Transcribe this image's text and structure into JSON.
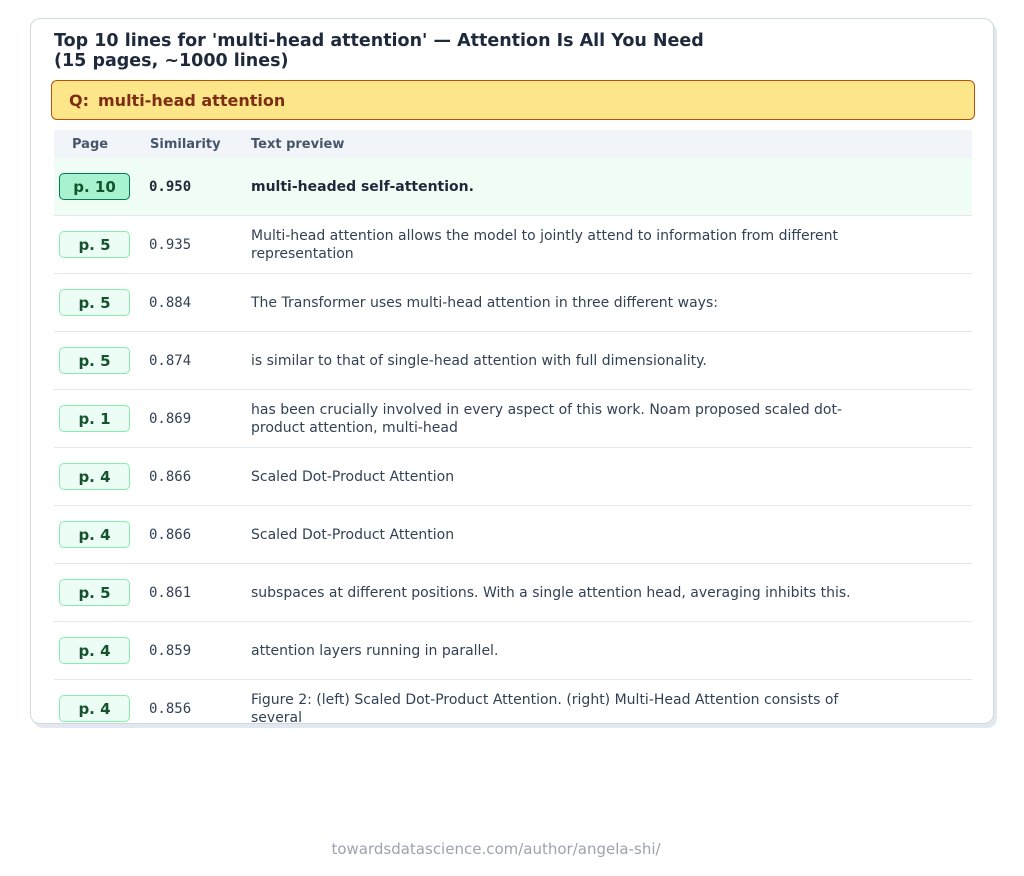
{
  "title_line1": "Top 10 lines for 'multi-head attention' — Attention Is All You Need",
  "title_line2": "(15 pages, ~1000 lines)",
  "query": {
    "prefix": "Q:",
    "text": "multi-head attention"
  },
  "table": {
    "headers": {
      "page": "Page",
      "similarity": "Similarity",
      "text": "Text preview"
    },
    "rows": [
      {
        "page": "p. 10",
        "similarity": "0.950",
        "text": "multi-headed self-attention."
      },
      {
        "page": "p. 5",
        "similarity": "0.935",
        "text": "Multi-head attention allows the model to jointly attend to information from different representation"
      },
      {
        "page": "p. 5",
        "similarity": "0.884",
        "text": "The Transformer uses multi-head attention in three different ways:"
      },
      {
        "page": "p. 5",
        "similarity": "0.874",
        "text": "is similar to that of single-head attention with full dimensionality."
      },
      {
        "page": "p. 1",
        "similarity": "0.869",
        "text": "has been crucially involved in every aspect of this work. Noam proposed scaled dot-product attention, multi-head"
      },
      {
        "page": "p. 4",
        "similarity": "0.866",
        "text": "Scaled Dot-Product Attention"
      },
      {
        "page": "p. 4",
        "similarity": "0.866",
        "text": "Scaled Dot-Product Attention"
      },
      {
        "page": "p. 5",
        "similarity": "0.861",
        "text": "subspaces at different positions. With a single attention head, averaging inhibits this."
      },
      {
        "page": "p. 4",
        "similarity": "0.859",
        "text": "attention layers running in parallel."
      },
      {
        "page": "p. 4",
        "similarity": "0.856",
        "text": "Figure 2: (left) Scaled Dot-Product Attention. (right) Multi-Head Attention consists of several"
      }
    ]
  },
  "footer": "towardsdatascience.com/author/angela-shi/",
  "colors": {
    "query_bg": "#fde68a",
    "query_border": "#b45309",
    "top_row_bg": "#f0fdf4",
    "badge_border": "#86efac",
    "top_badge_bg": "#a7f3d0"
  }
}
